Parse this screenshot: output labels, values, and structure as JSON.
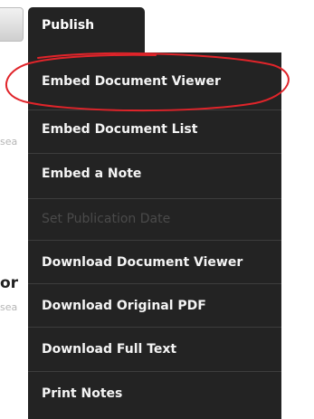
{
  "background": {
    "snippet_1": "sea",
    "snippet_2": "or",
    "snippet_3": "sea"
  },
  "publish_tab": {
    "label": "Publish"
  },
  "menu": {
    "items": [
      {
        "label": "Embed Document Viewer",
        "disabled": false,
        "highlighted": true
      },
      {
        "label": "Embed Document List",
        "disabled": false
      },
      {
        "label": "Embed a Note",
        "disabled": false
      },
      {
        "label": "Set Publication Date",
        "disabled": true
      },
      {
        "label": "Download Document Viewer",
        "disabled": false
      },
      {
        "label": "Download Original PDF",
        "disabled": false
      },
      {
        "label": "Download Full Text",
        "disabled": false
      },
      {
        "label": "Print Notes",
        "disabled": false
      }
    ]
  },
  "colors": {
    "menu_bg": "#232323",
    "text": "#f4f4f4",
    "disabled_text": "#4a4a4a",
    "annotation": "#e0242a"
  }
}
